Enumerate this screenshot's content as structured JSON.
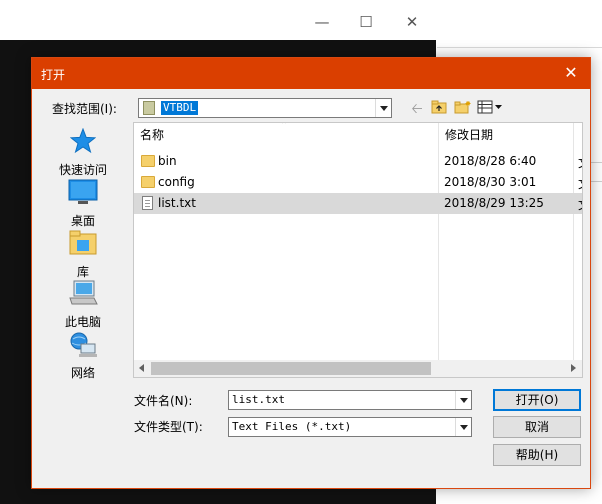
{
  "dialog": {
    "title": "打开",
    "look_in_label": "查找范围(I):",
    "look_in_value": "VTBDL",
    "places": [
      {
        "label": "快速访问",
        "icon": "star-icon"
      },
      {
        "label": "桌面",
        "icon": "desktop-icon"
      },
      {
        "label": "库",
        "icon": "library-icon"
      },
      {
        "label": "此电脑",
        "icon": "computer-icon"
      },
      {
        "label": "网络",
        "icon": "network-icon"
      }
    ],
    "columns": {
      "name": "名称",
      "date": "修改日期"
    },
    "files": [
      {
        "name": "bin",
        "date": "2018/8/28 6:40",
        "type": "folder",
        "type_peek": "文"
      },
      {
        "name": "config",
        "date": "2018/8/30 3:01",
        "type": "folder",
        "type_peek": "文"
      },
      {
        "name": "list.txt",
        "date": "2018/8/29 13:25",
        "type": "file",
        "type_peek": "文",
        "selected": true
      }
    ],
    "filename_label": "文件名(N):",
    "filename_value": "list.txt",
    "filetype_label": "文件类型(T):",
    "filetype_value": "Text Files (*.txt)",
    "buttons": {
      "open": "打开(O)",
      "cancel": "取消",
      "help": "帮助(H)"
    }
  },
  "colors": {
    "titlebar": "#da3f00",
    "selection": "#0078d7",
    "row_selected": "#d9d9d9"
  }
}
